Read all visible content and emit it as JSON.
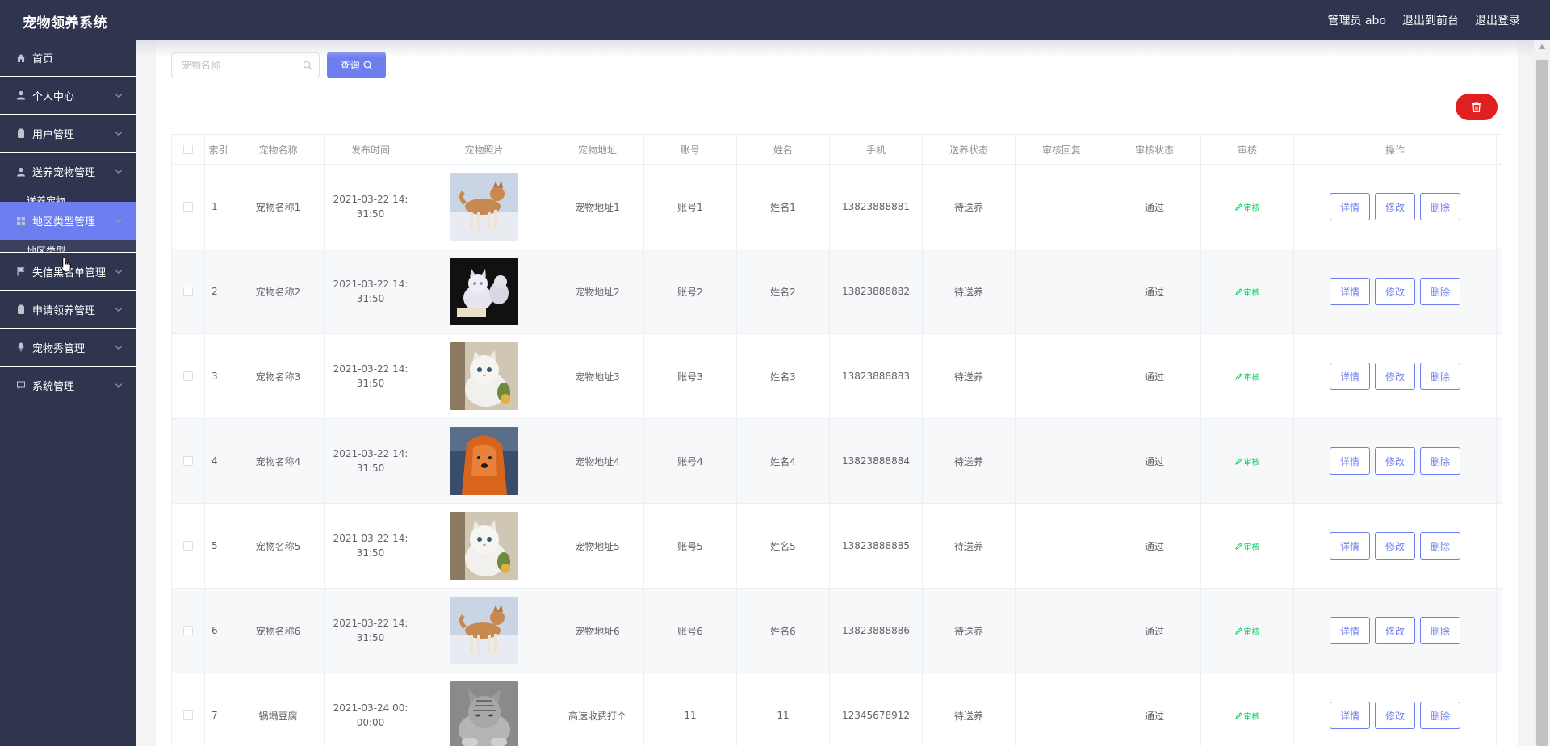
{
  "app": {
    "title": "宠物领养系统"
  },
  "header": {
    "user_label": "管理员 abo",
    "front_label": "退出到前台",
    "logout_label": "退出登录"
  },
  "sidebar": {
    "items": [
      {
        "label": "首页",
        "icon": "home-icon",
        "expandable": false
      },
      {
        "label": "个人中心",
        "icon": "user-icon",
        "expandable": true
      },
      {
        "label": "用户管理",
        "icon": "clipboard-icon",
        "expandable": true
      },
      {
        "label": "送养宠物管理",
        "icon": "user-icon",
        "expandable": true,
        "submenu": "送养宠物"
      },
      {
        "label": "地区类型管理",
        "icon": "grid-icon",
        "expandable": true,
        "active": true,
        "submenu": "地区类型"
      },
      {
        "label": "失信黑名单管理",
        "icon": "flag-icon",
        "expandable": true
      },
      {
        "label": "申请领养管理",
        "icon": "clipboard-icon",
        "expandable": true
      },
      {
        "label": "宠物秀管理",
        "icon": "microphone-icon",
        "expandable": true
      },
      {
        "label": "系统管理",
        "icon": "chat-icon",
        "expandable": true
      }
    ]
  },
  "search": {
    "placeholder": "宠物名称",
    "button_label": "查询"
  },
  "table": {
    "columns": [
      "索引",
      "宠物名称",
      "发布时间",
      "宠物照片",
      "宠物地址",
      "账号",
      "姓名",
      "手机",
      "送养状态",
      "审核回复",
      "审核状态",
      "审核",
      "操作"
    ],
    "audit_label": "审核",
    "actions": {
      "detail": "详情",
      "edit": "修改",
      "delete": "删除"
    },
    "rows": [
      {
        "index": "1",
        "name": "宠物名称1",
        "time": "2021-03-22 14:31:50",
        "photo": "shiba-dog-in-snow",
        "address": "宠物地址1",
        "account": "账号1",
        "realname": "姓名1",
        "phone": "13823888881",
        "state": "待送养",
        "reply": "",
        "audit_status": "通过"
      },
      {
        "index": "2",
        "name": "宠物名称2",
        "time": "2021-03-22 14:31:50",
        "photo": "white-kittens-dark-background",
        "address": "宠物地址2",
        "account": "账号2",
        "realname": "姓名2",
        "phone": "13823888882",
        "state": "待送养",
        "reply": "",
        "audit_status": "通过"
      },
      {
        "index": "3",
        "name": "宠物名称3",
        "time": "2021-03-22 14:31:50",
        "photo": "white-persian-cat",
        "address": "宠物地址3",
        "account": "账号3",
        "realname": "姓名3",
        "phone": "13823888883",
        "state": "待送养",
        "reply": "",
        "audit_status": "通过"
      },
      {
        "index": "4",
        "name": "宠物名称4",
        "time": "2021-03-22 14:31:50",
        "photo": "orange-long-hair-dog",
        "address": "宠物地址4",
        "account": "账号4",
        "realname": "姓名4",
        "phone": "13823888884",
        "state": "待送养",
        "reply": "",
        "audit_status": "通过"
      },
      {
        "index": "5",
        "name": "宠物名称5",
        "time": "2021-03-22 14:31:50",
        "photo": "white-persian-cat",
        "address": "宠物地址5",
        "account": "账号5",
        "realname": "姓名5",
        "phone": "13823888885",
        "state": "待送养",
        "reply": "",
        "audit_status": "通过"
      },
      {
        "index": "6",
        "name": "宠物名称6",
        "time": "2021-03-22 14:31:50",
        "photo": "shiba-dog-in-snow",
        "address": "宠物地址6",
        "account": "账号6",
        "realname": "姓名6",
        "phone": "13823888886",
        "state": "待送养",
        "reply": "",
        "audit_status": "通过"
      },
      {
        "index": "7",
        "name": "锅塌豆腐",
        "time": "2021-03-24 00:00:00",
        "photo": "grey-tabby-cat",
        "address": "高速收费打个",
        "account": "11",
        "realname": "11",
        "phone": "12345678912",
        "state": "待送养",
        "reply": "",
        "audit_status": "通过"
      }
    ]
  },
  "colors": {
    "sidebar_bg": "#30354f",
    "accent": "#6d7ff0",
    "danger": "#e02020",
    "audit_green": "#13ce66"
  }
}
